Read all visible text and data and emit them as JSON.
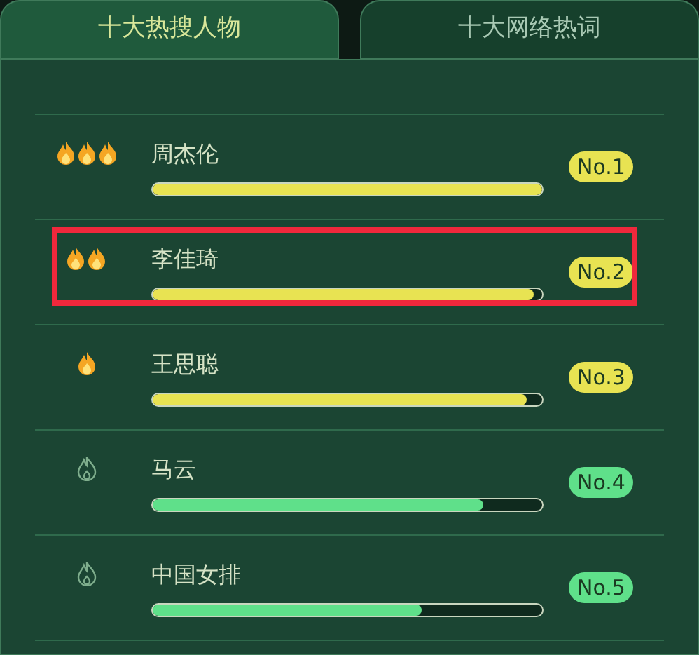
{
  "tabs": [
    {
      "label": "十大热搜人物",
      "selected": true
    },
    {
      "label": "十大网络热词",
      "selected": false
    }
  ],
  "ranking": [
    {
      "kind": "triple",
      "name": "周杰伦",
      "level": 1.0,
      "color": "#e8e352",
      "rank": "No.1",
      "highlighted": false
    },
    {
      "kind": "double",
      "name": "李佳琦",
      "level": 0.98,
      "color": "#e8e352",
      "rank": "No.2",
      "highlighted": true
    },
    {
      "kind": "single",
      "name": "王思聪",
      "level": 0.96,
      "color": "#e8e352",
      "rank": "No.3",
      "highlighted": false
    },
    {
      "kind": "outline",
      "name": "马云",
      "level": 0.85,
      "color": "#5fe08a",
      "rank": "No.4",
      "highlighted": false
    },
    {
      "kind": "outline",
      "name": "中国女排",
      "level": 0.69,
      "color": "#5fe08a",
      "rank": "No.5",
      "highlighted": false
    }
  ]
}
